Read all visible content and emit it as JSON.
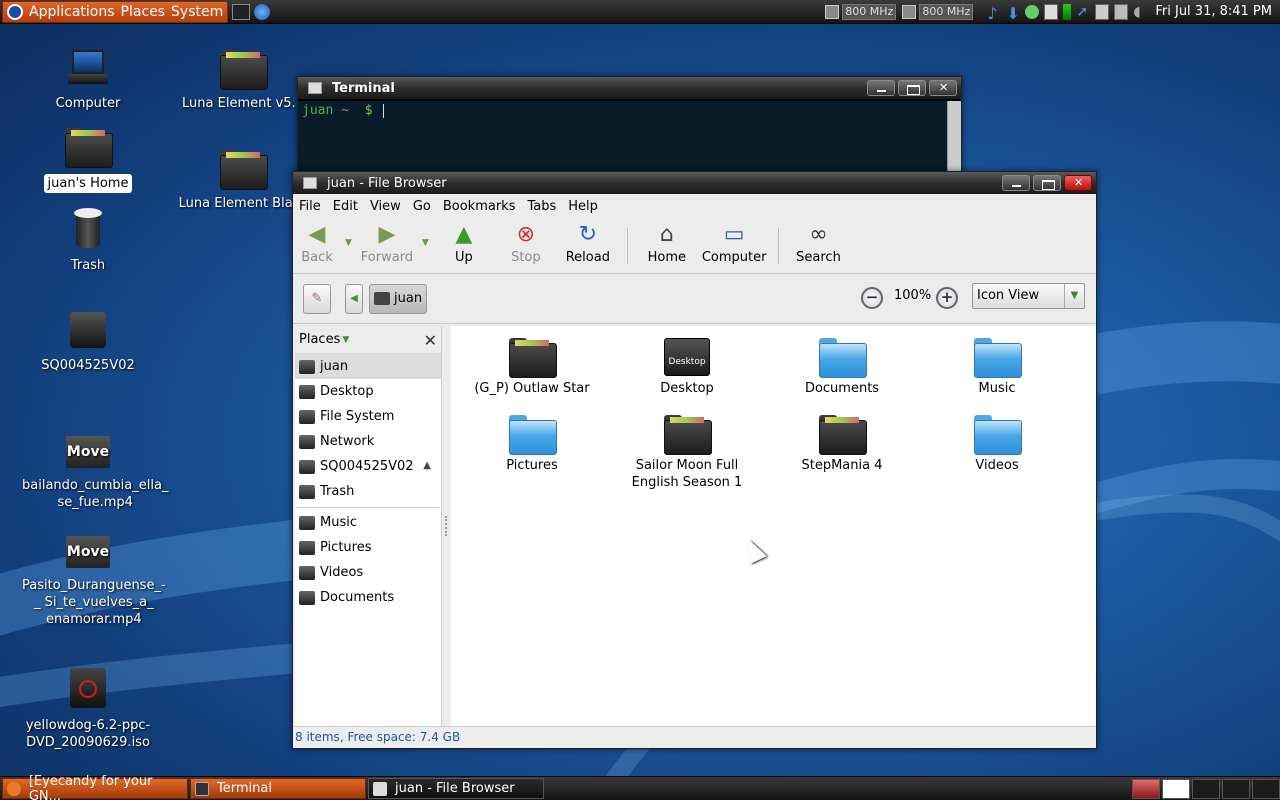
{
  "top_panel": {
    "menus": [
      "Applications",
      "Places",
      "System"
    ],
    "cpu1": "800 MHz",
    "cpu2": "800 MHz",
    "clock": "Fri Jul 31,  8:41 PM"
  },
  "desktop": {
    "icons": [
      {
        "label": "Computer"
      },
      {
        "label": "Luna Element v5.1"
      },
      {
        "label": "juan's Home"
      },
      {
        "label": "Luna Element Black"
      },
      {
        "label": "Trash"
      },
      {
        "label": "SQ004525V02"
      },
      {
        "label": "bailando_cumbia_ella_ se_fue.mp4",
        "badge": "Move"
      },
      {
        "label": "Pasito_Duranguense_-_ Si_te_vuelves_a_ enamorar.mp4",
        "badge": "Move"
      },
      {
        "label": "yellowdog-6.2-ppc-DVD_20090629.iso"
      }
    ]
  },
  "terminal": {
    "title": "Terminal",
    "prompt_user": "juan",
    "prompt_dir": "~",
    "prompt_sym": "$"
  },
  "file_browser": {
    "title": "juan - File Browser",
    "menu": [
      "File",
      "Edit",
      "View",
      "Go",
      "Bookmarks",
      "Tabs",
      "Help"
    ],
    "toolbar": {
      "back": "Back",
      "forward": "Forward",
      "up": "Up",
      "stop": "Stop",
      "reload": "Reload",
      "home": "Home",
      "computer": "Computer",
      "search": "Search"
    },
    "location": "juan",
    "zoom": "100%",
    "view_mode": "Icon View",
    "sidebar_title": "Places",
    "places": [
      "juan",
      "Desktop",
      "File System",
      "Network",
      "SQ004525V02",
      "Trash"
    ],
    "bookmarks": [
      "Music",
      "Pictures",
      "Videos",
      "Documents"
    ],
    "items": [
      {
        "name": "(G_P) Outlaw Star"
      },
      {
        "name": "Desktop"
      },
      {
        "name": "Documents"
      },
      {
        "name": "Music"
      },
      {
        "name": "Pictures"
      },
      {
        "name": "Sailor Moon Full English Season 1"
      },
      {
        "name": "StepMania 4"
      },
      {
        "name": "Videos"
      }
    ],
    "desktop_badge": "Desktop",
    "status": "8 items, Free space: 7.4 GB"
  },
  "taskbar": {
    "tasks": [
      "[Eyecandy for your GN...",
      "Terminal",
      "juan - File Browser"
    ]
  }
}
